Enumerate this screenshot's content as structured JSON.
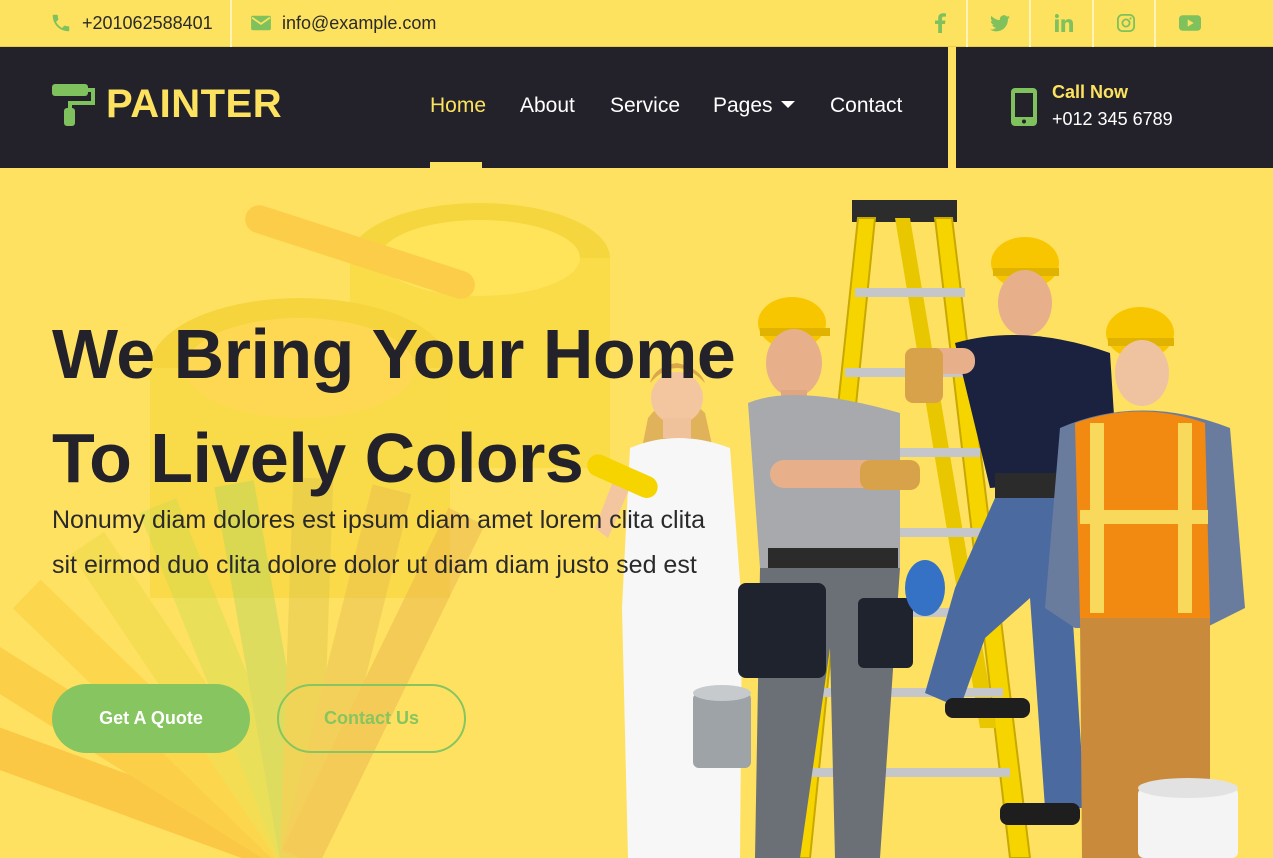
{
  "topbar": {
    "phone": "+201062588401",
    "email": "info@example.com",
    "socials": [
      "facebook-icon",
      "twitter-icon",
      "linkedin-icon",
      "instagram-icon",
      "youtube-icon"
    ],
    "social_glyphs": [
      "f",
      "t",
      "in",
      "ig",
      "yt"
    ]
  },
  "brand": {
    "name": "PAINTER"
  },
  "nav": {
    "items": [
      {
        "label": "Home",
        "active": true
      },
      {
        "label": "About"
      },
      {
        "label": "Service"
      },
      {
        "label": "Pages",
        "dropdown": true
      },
      {
        "label": "Contact"
      }
    ]
  },
  "call": {
    "label": "Call Now",
    "number": "+012 345 6789"
  },
  "hero": {
    "title_line1": "We Bring Your Home",
    "title_line2": "To Lively Colors",
    "text": "Nonumy diam dolores est ipsum diam amet lorem clita clita sit eirmod duo clita dolore dolor ut diam diam justo sed est",
    "primary_button": "Get A Quote",
    "secondary_button": "Contact Us"
  },
  "colors": {
    "yellow": "#fde25f",
    "dark": "#23222b",
    "green": "#86c55f"
  }
}
